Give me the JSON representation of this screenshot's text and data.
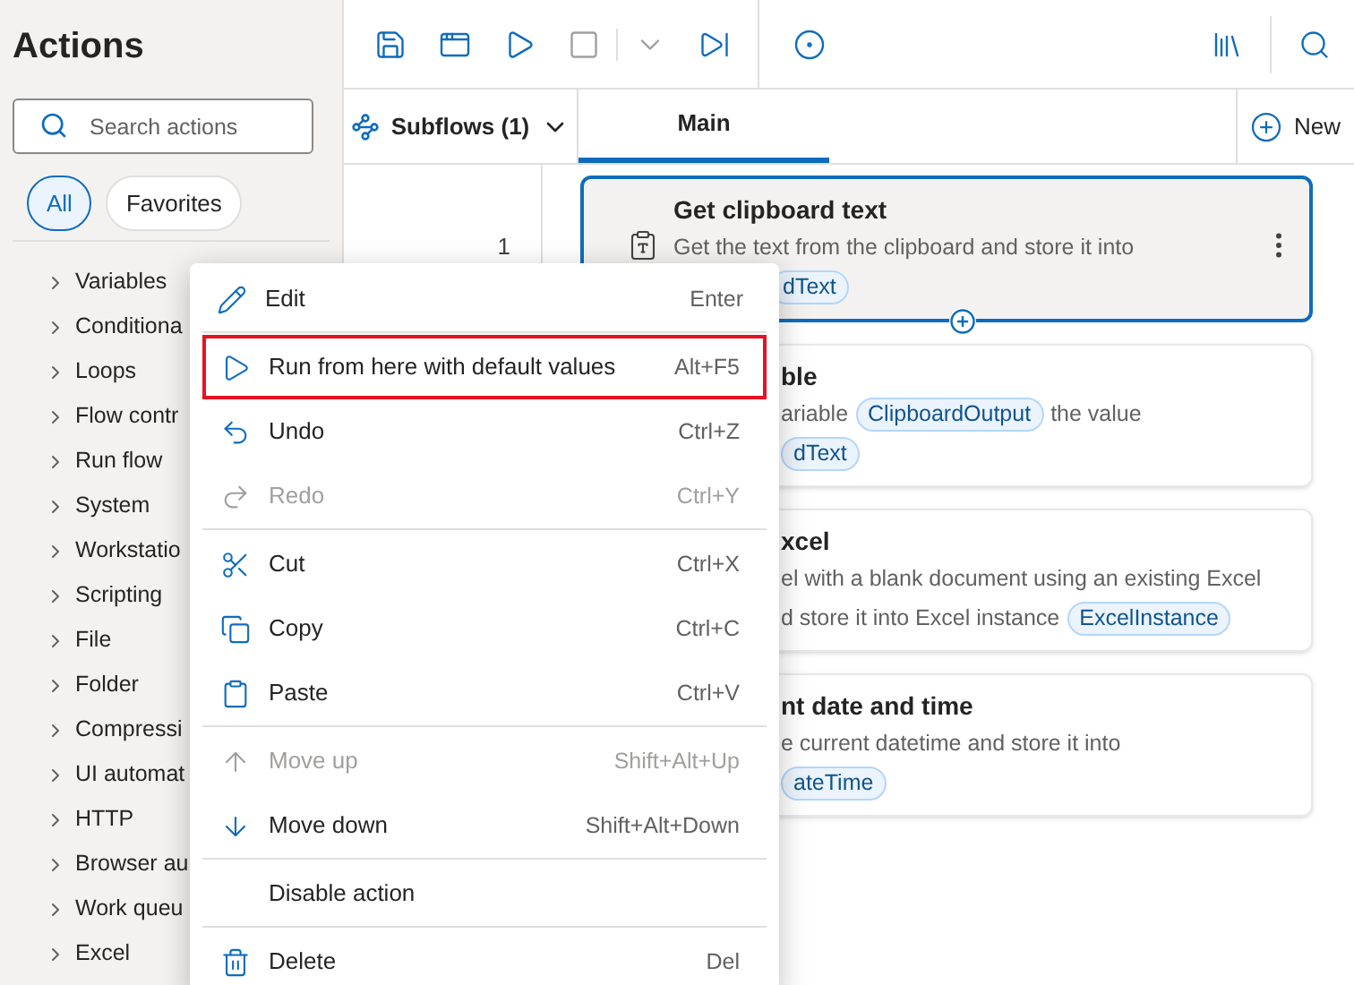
{
  "sidebar": {
    "title": "Actions",
    "search": {
      "placeholder": "Search actions"
    },
    "filters": [
      {
        "label": "All",
        "selected": true
      },
      {
        "label": "Favorites",
        "selected": false
      }
    ],
    "items": [
      "Variables",
      "Conditiona",
      "Loops",
      "Flow contr",
      "Run flow",
      "System",
      "Workstatio",
      "Scripting",
      "File",
      "Folder",
      "Compressi",
      "UI automat",
      "HTTP",
      "Browser au",
      "Work queu",
      "Excel"
    ]
  },
  "tabs": {
    "subflows": "Subflows (1)",
    "items": [
      {
        "label": "Main",
        "selected": true
      }
    ],
    "new": "New"
  },
  "line_numbers": [
    "1"
  ],
  "cards": [
    {
      "title": "Get clipboard text",
      "selected": true,
      "lines": [
        [
          {
            "text": "Get the text from the clipboard and store it into"
          }
        ],
        [
          {
            "var": "dText"
          }
        ]
      ]
    },
    {
      "title": "ble",
      "selected": false,
      "lines": [
        [
          {
            "text": "ariable"
          },
          {
            "var": "ClipboardOutput"
          },
          {
            "text": "the value"
          }
        ],
        [
          {
            "var": "dText"
          }
        ]
      ]
    },
    {
      "title": "xcel",
      "selected": false,
      "lines": [
        [
          {
            "text": "el with a blank document using an existing Excel"
          }
        ],
        [
          {
            "text": "d store it into Excel instance"
          },
          {
            "var": "ExcelInstance"
          }
        ]
      ]
    },
    {
      "title": "nt date and time",
      "selected": false,
      "lines": [
        [
          {
            "text": "e current datetime and store it into"
          }
        ],
        [
          {
            "var": "ateTime"
          }
        ]
      ]
    }
  ],
  "context_menu": {
    "sections": [
      [
        {
          "label": "Edit",
          "shortcut": "Enter",
          "disabled": false,
          "highlighted": false
        }
      ],
      [
        {
          "label": "Run from here with default values",
          "shortcut": "Alt+F5",
          "disabled": false,
          "highlighted": true
        },
        {
          "label": "Undo",
          "shortcut": "Ctrl+Z",
          "disabled": false,
          "highlighted": false
        },
        {
          "label": "Redo",
          "shortcut": "Ctrl+Y",
          "disabled": true,
          "highlighted": false
        }
      ],
      [
        {
          "label": "Cut",
          "shortcut": "Ctrl+X",
          "disabled": false,
          "highlighted": false
        },
        {
          "label": "Copy",
          "shortcut": "Ctrl+C",
          "disabled": false,
          "highlighted": false
        },
        {
          "label": "Paste",
          "shortcut": "Ctrl+V",
          "disabled": false,
          "highlighted": false
        }
      ],
      [
        {
          "label": "Move up",
          "shortcut": "Shift+Alt+Up",
          "disabled": true,
          "highlighted": false
        },
        {
          "label": "Move down",
          "shortcut": "Shift+Alt+Down",
          "disabled": false,
          "highlighted": false
        }
      ],
      [
        {
          "label": "Disable action",
          "disabled": false,
          "highlighted": false
        }
      ],
      [
        {
          "label": "Delete",
          "shortcut": "Del",
          "disabled": false,
          "highlighted": false
        }
      ]
    ]
  }
}
